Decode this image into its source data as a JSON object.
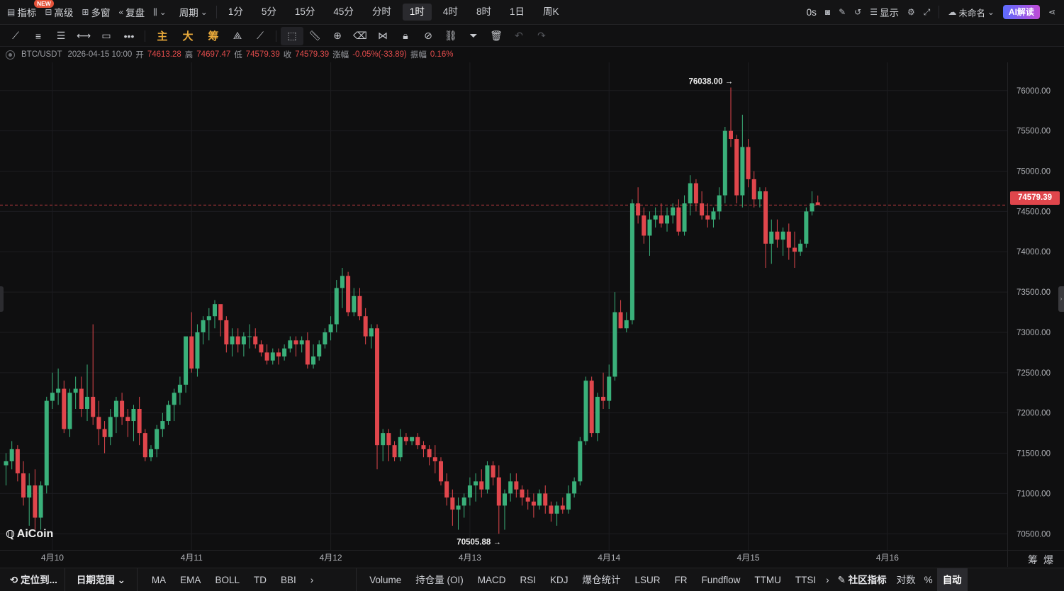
{
  "topbar": {
    "indicators_label": "指标",
    "new_badge": "NEW",
    "advanced_label": "高级",
    "multi_window_label": "多窗",
    "replay_label": "复盘",
    "period_label": "周期",
    "timeframes": [
      "1分",
      "5分",
      "15分",
      "45分",
      "分时",
      "1时",
      "4时",
      "8时",
      "1日",
      "周K"
    ],
    "active_timeframe": "1时",
    "countdown": "0s",
    "display_label": "显示",
    "layout_name": "未命名",
    "ai_label": "AI解读"
  },
  "drawbar": {
    "gold_tools": [
      "主",
      "大",
      "筹"
    ]
  },
  "info": {
    "symbol": "BTC/USDT",
    "datetime": "2026-04-15 10:00",
    "open_label": "开",
    "open": "74613.28",
    "high_label": "高",
    "high": "74697.47",
    "low_label": "低",
    "low": "74579.39",
    "close_label": "收",
    "close": "74579.39",
    "change_label": "涨幅",
    "change": "-0.05%(-33.89)",
    "amplitude_label": "振幅",
    "amplitude": "0.16%"
  },
  "chart_data": {
    "type": "candlestick",
    "title": "BTC/USDT",
    "xlabel": "",
    "ylabel": "",
    "ylim": [
      70300,
      76350
    ],
    "y_ticks": [
      70500,
      71000,
      71500,
      72000,
      72500,
      73000,
      73500,
      74000,
      74500,
      75000,
      75500,
      76000
    ],
    "y_tick_labels": [
      "70500.00",
      "71000.00",
      "71500.00",
      "72000.00",
      "72500.00",
      "73000.00",
      "73500.00",
      "74000.00",
      "74500.00",
      "75000.00",
      "75500.00",
      "76000.00"
    ],
    "x_ticks": [
      {
        "label": "4月10",
        "index": 8
      },
      {
        "label": "4月11",
        "index": 32
      },
      {
        "label": "4月12",
        "index": 56
      },
      {
        "label": "4月13",
        "index": 80
      },
      {
        "label": "4月14",
        "index": 104
      },
      {
        "label": "4月15",
        "index": 128
      },
      {
        "label": "4月16",
        "index": 152
      }
    ],
    "last_price": 74579.39,
    "last_price_label": "74579.39",
    "annotations": [
      {
        "text": "76038.00 →",
        "index": 126,
        "value": 76038
      },
      {
        "text": "70505.88 →",
        "index": 86,
        "value": 70505.88
      }
    ],
    "up_color": "#3ab07a",
    "down_color": "#e0464c",
    "candles": [
      [
        71350,
        71500,
        71100,
        71400
      ],
      [
        71400,
        71650,
        71300,
        71550
      ],
      [
        71550,
        71600,
        71150,
        71250
      ],
      [
        71250,
        71400,
        70850,
        70950
      ],
      [
        70950,
        71250,
        70600,
        71100
      ],
      [
        71100,
        71300,
        70550,
        70700
      ],
      [
        70700,
        71150,
        70550,
        71100
      ],
      [
        71100,
        72200,
        71000,
        72150
      ],
      [
        72150,
        72500,
        72050,
        72250
      ],
      [
        72250,
        72550,
        72100,
        72300
      ],
      [
        72300,
        72400,
        71750,
        71800
      ],
      [
        71800,
        72300,
        71700,
        72250
      ],
      [
        72250,
        72450,
        72050,
        72300
      ],
      [
        72300,
        72450,
        71950,
        72050
      ],
      [
        72050,
        72600,
        71900,
        72200
      ],
      [
        72200,
        73100,
        71850,
        71950
      ],
      [
        71950,
        72150,
        71600,
        71800
      ],
      [
        71800,
        71900,
        71500,
        71700
      ],
      [
        71700,
        72050,
        71600,
        71950
      ],
      [
        71950,
        72200,
        71750,
        72150
      ],
      [
        72150,
        72250,
        71850,
        71950
      ],
      [
        71950,
        72050,
        71700,
        71900
      ],
      [
        71900,
        72100,
        71650,
        72050
      ],
      [
        72050,
        72200,
        71600,
        71750
      ],
      [
        71750,
        71800,
        71400,
        71450
      ],
      [
        71450,
        71600,
        71400,
        71550
      ],
      [
        71550,
        71850,
        71450,
        71800
      ],
      [
        71800,
        72000,
        71700,
        71900
      ],
      [
        71900,
        72150,
        71850,
        72100
      ],
      [
        72100,
        72300,
        71900,
        72250
      ],
      [
        72250,
        72450,
        72100,
        72350
      ],
      [
        72350,
        72900,
        72250,
        72950
      ],
      [
        72950,
        73250,
        72500,
        72550
      ],
      [
        72550,
        73100,
        72450,
        73000
      ],
      [
        73000,
        73200,
        72850,
        73150
      ],
      [
        73150,
        73300,
        72900,
        73200
      ],
      [
        73200,
        73400,
        73050,
        73350
      ],
      [
        73350,
        73300,
        72950,
        73150
      ],
      [
        73150,
        73200,
        72750,
        72850
      ],
      [
        72850,
        73050,
        72700,
        72950
      ],
      [
        72950,
        73050,
        72750,
        72850
      ],
      [
        72850,
        73000,
        72700,
        72950
      ],
      [
        72950,
        73100,
        72800,
        72950
      ],
      [
        72950,
        73050,
        72800,
        72850
      ],
      [
        72850,
        72900,
        72700,
        72750
      ],
      [
        72750,
        72850,
        72600,
        72650
      ],
      [
        72650,
        72800,
        72600,
        72750
      ],
      [
        72750,
        72800,
        72600,
        72700
      ],
      [
        72700,
        72850,
        72650,
        72800
      ],
      [
        72800,
        72950,
        72750,
        72900
      ],
      [
        72900,
        72950,
        72700,
        72850
      ],
      [
        72850,
        72950,
        72750,
        72900
      ],
      [
        72900,
        73000,
        72550,
        72600
      ],
      [
        72600,
        72850,
        72550,
        72700
      ],
      [
        72700,
        72900,
        72650,
        72850
      ],
      [
        72850,
        73050,
        72800,
        73000
      ],
      [
        73000,
        73200,
        72900,
        73100
      ],
      [
        73100,
        73650,
        73000,
        73550
      ],
      [
        73550,
        73800,
        73300,
        73700
      ],
      [
        73700,
        73750,
        73200,
        73250
      ],
      [
        73250,
        73550,
        73200,
        73450
      ],
      [
        73450,
        73550,
        73150,
        73200
      ],
      [
        73200,
        73300,
        72850,
        72950
      ],
      [
        72950,
        73100,
        72800,
        73050
      ],
      [
        73050,
        73100,
        71300,
        71600
      ],
      [
        71600,
        71800,
        71400,
        71750
      ],
      [
        71750,
        71800,
        71400,
        71600
      ],
      [
        71600,
        71650,
        71400,
        71450
      ],
      [
        71450,
        71800,
        71400,
        71700
      ],
      [
        71700,
        71750,
        71600,
        71650
      ],
      [
        71650,
        71700,
        71600,
        71700
      ],
      [
        71700,
        71750,
        71550,
        71600
      ],
      [
        71600,
        71650,
        71450,
        71550
      ],
      [
        71550,
        71600,
        71350,
        71450
      ],
      [
        71450,
        71600,
        71250,
        71400
      ],
      [
        71400,
        71450,
        71100,
        71150
      ],
      [
        71150,
        71250,
        70850,
        70950
      ],
      [
        70950,
        71050,
        70600,
        70800
      ],
      [
        70800,
        70950,
        70550,
        70850
      ],
      [
        70850,
        71000,
        70700,
        70950
      ],
      [
        70950,
        71200,
        70850,
        71100
      ],
      [
        71100,
        71250,
        70900,
        71150
      ],
      [
        71150,
        71300,
        70950,
        71050
      ],
      [
        71050,
        71400,
        71000,
        71350
      ],
      [
        71350,
        71400,
        71100,
        71200
      ],
      [
        71200,
        71350,
        70500,
        70850
      ],
      [
        70850,
        71050,
        70550,
        71000
      ],
      [
        71000,
        71250,
        70900,
        71150
      ],
      [
        71150,
        71250,
        70950,
        71050
      ],
      [
        71050,
        71100,
        70850,
        70950
      ],
      [
        70950,
        71050,
        70800,
        70900
      ],
      [
        70900,
        71000,
        70700,
        70850
      ],
      [
        70850,
        71050,
        70800,
        71000
      ],
      [
        71000,
        71100,
        70750,
        70850
      ],
      [
        70850,
        70900,
        70650,
        70750
      ],
      [
        70750,
        70900,
        70600,
        70850
      ],
      [
        70850,
        70950,
        70750,
        70800
      ],
      [
        70800,
        71100,
        70750,
        71000
      ],
      [
        71000,
        71200,
        70950,
        71150
      ],
      [
        71150,
        71700,
        71100,
        71650
      ],
      [
        71650,
        72450,
        71600,
        72400
      ],
      [
        72400,
        72450,
        71700,
        71750
      ],
      [
        71750,
        72250,
        71650,
        72200
      ],
      [
        72200,
        72500,
        72050,
        72150
      ],
      [
        72150,
        72600,
        72050,
        72450
      ],
      [
        72450,
        73500,
        72400,
        73250
      ],
      [
        73250,
        73400,
        73050,
        73050
      ],
      [
        73050,
        73250,
        73000,
        73150
      ],
      [
        73150,
        74650,
        73100,
        74600
      ],
      [
        74600,
        74800,
        74350,
        74450
      ],
      [
        74450,
        74550,
        74100,
        74200
      ],
      [
        74200,
        74500,
        73950,
        74400
      ],
      [
        74400,
        74550,
        74300,
        74450
      ],
      [
        74450,
        74600,
        74300,
        74350
      ],
      [
        74350,
        74550,
        74250,
        74450
      ],
      [
        74450,
        74600,
        74350,
        74550
      ],
      [
        74550,
        74650,
        74200,
        74250
      ],
      [
        74250,
        74700,
        74200,
        74600
      ],
      [
        74600,
        74950,
        74450,
        74850
      ],
      [
        74850,
        74900,
        74500,
        74600
      ],
      [
        74600,
        74750,
        74400,
        74450
      ],
      [
        74450,
        74600,
        74300,
        74400
      ],
      [
        74400,
        74550,
        74300,
        74500
      ],
      [
        74500,
        74800,
        74400,
        74700
      ],
      [
        74700,
        75550,
        74600,
        75500
      ],
      [
        75500,
        76038,
        75300,
        75400
      ],
      [
        75400,
        75450,
        74600,
        74700
      ],
      [
        74700,
        75700,
        74550,
        75300
      ],
      [
        75300,
        75400,
        74800,
        74900
      ],
      [
        74900,
        75000,
        74550,
        74650
      ],
      [
        74650,
        74800,
        74550,
        74750
      ],
      [
        74750,
        74800,
        73800,
        74100
      ],
      [
        74100,
        74400,
        73850,
        74250
      ],
      [
        74250,
        74400,
        74050,
        74150
      ],
      [
        74150,
        74300,
        73950,
        74250
      ],
      [
        74250,
        74350,
        73900,
        74050
      ],
      [
        74050,
        74250,
        73800,
        74000
      ],
      [
        74000,
        74150,
        73950,
        74100
      ],
      [
        74100,
        74550,
        74050,
        74500
      ],
      [
        74500,
        74750,
        74450,
        74600
      ],
      [
        74613.28,
        74697.47,
        74579.39,
        74579.39
      ]
    ]
  },
  "axis_corner": [
    "筹",
    "爆"
  ],
  "logo_text": "AiCoin",
  "bottombar": {
    "locate_label": "定位到...",
    "date_range_label": "日期范围",
    "main_indicators": [
      "MA",
      "EMA",
      "BOLL",
      "TD",
      "BBI"
    ],
    "sub_indicators": [
      "Volume",
      "持仓量 (OI)",
      "MACD",
      "RSI",
      "KDJ",
      "爆仓统计",
      "LSUR",
      "FR",
      "Fundflow",
      "TTMU",
      "TTSI"
    ],
    "community_label": "社区指标",
    "log_label": "对数",
    "percent_label": "%",
    "auto_label": "自动"
  }
}
